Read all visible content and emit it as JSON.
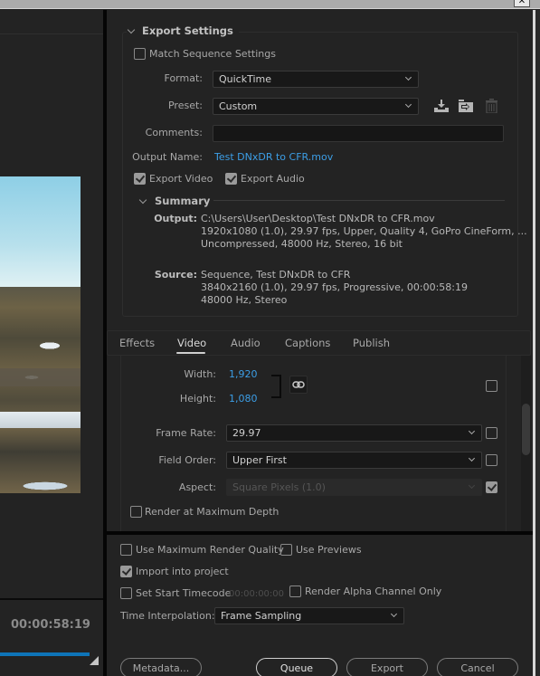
{
  "window": {
    "close_glyph": "✕"
  },
  "preview": {
    "timecode": "00:00:58:19",
    "progress": 1.0
  },
  "export_settings": {
    "title": "Export Settings",
    "match_sequence": {
      "label": "Match Sequence Settings",
      "checked": false
    },
    "format": {
      "label": "Format:",
      "value": "QuickTime"
    },
    "preset": {
      "label": "Preset:",
      "value": "Custom"
    },
    "comments": {
      "label": "Comments:",
      "value": ""
    },
    "output_name": {
      "label": "Output Name:",
      "value": "Test DNxDR to CFR.mov"
    },
    "export_video": {
      "label": "Export Video",
      "checked": true
    },
    "export_audio": {
      "label": "Export Audio",
      "checked": true
    },
    "preset_icons": [
      "save-preset-icon",
      "import-preset-icon",
      "delete-preset-icon"
    ]
  },
  "summary": {
    "title": "Summary",
    "output_key": "Output:",
    "output_lines": [
      "C:\\Users\\User\\Desktop\\Test DNxDR to CFR.mov",
      "1920x1080 (1.0), 29.97 fps, Upper, Quality 4, GoPro CineForm, ...",
      "Uncompressed, 48000 Hz, Stereo, 16 bit"
    ],
    "source_key": "Source:",
    "source_lines": [
      "Sequence, Test DNxDR to  CFR",
      "3840x2160 (1.0), 29.97 fps, Progressive, 00:00:58:19",
      "48000 Hz, Stereo"
    ]
  },
  "tabs": [
    {
      "label": "Effects",
      "active": false
    },
    {
      "label": "Video",
      "active": true
    },
    {
      "label": "Audio",
      "active": false
    },
    {
      "label": "Captions",
      "active": false
    },
    {
      "label": "Publish",
      "active": false
    }
  ],
  "video": {
    "width_label": "Width:",
    "width_value": "1,920",
    "height_label": "Height:",
    "height_value": "1,080",
    "size_override_checked": false,
    "frame_rate": {
      "label": "Frame Rate:",
      "value": "29.97",
      "checked": false
    },
    "field_order": {
      "label": "Field Order:",
      "value": "Upper First",
      "checked": false
    },
    "aspect": {
      "label": "Aspect:",
      "value": "Square Pixels (1.0)",
      "checked": true,
      "disabled": true
    },
    "render_max_depth": {
      "label": "Render at Maximum Depth",
      "checked": false
    }
  },
  "options": {
    "max_render_quality": {
      "label": "Use Maximum Render Quality",
      "checked": false
    },
    "use_previews": {
      "label": "Use Previews",
      "checked": false
    },
    "import_into_project": {
      "label": "Import into project",
      "checked": true
    },
    "set_start_timecode": {
      "label": "Set Start Timecode",
      "checked": false,
      "value": "00:00:00:00"
    },
    "render_alpha_only": {
      "label": "Render Alpha Channel Only",
      "checked": false
    },
    "time_interpolation": {
      "label": "Time Interpolation:",
      "value": "Frame Sampling"
    }
  },
  "buttons": {
    "metadata": "Metadata...",
    "queue": "Queue",
    "export": "Export",
    "cancel": "Cancel"
  },
  "colors": {
    "accent_blue": "#3c9ee6",
    "progress_blue": "#0e74b8",
    "panel_bg": "#232323"
  }
}
